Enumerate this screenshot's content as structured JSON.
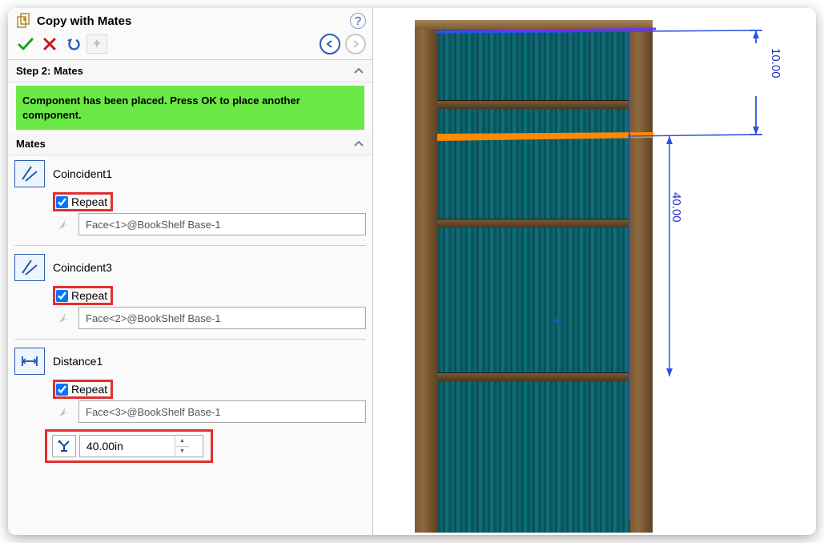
{
  "header": {
    "title": "Copy with Mates"
  },
  "step": {
    "title": "Step 2: Mates",
    "status": "Component has been placed. Press OK to place another component."
  },
  "mates_header": "Mates",
  "mates": [
    {
      "name": "Coincident1",
      "repeat_label": "Repeat",
      "repeat_checked": true,
      "face": "Face<1>@BookShelf Base-1",
      "type": "coincident"
    },
    {
      "name": "Coincident3",
      "repeat_label": "Repeat",
      "repeat_checked": true,
      "face": "Face<2>@BookShelf Base-1",
      "type": "coincident"
    },
    {
      "name": "Distance1",
      "repeat_label": "Repeat",
      "repeat_checked": true,
      "face": "Face<3>@BookShelf Base-1",
      "type": "distance",
      "distance_value": "40.00in"
    }
  ],
  "viewport": {
    "dim_top": "10.00",
    "dim_side": "40.00"
  }
}
